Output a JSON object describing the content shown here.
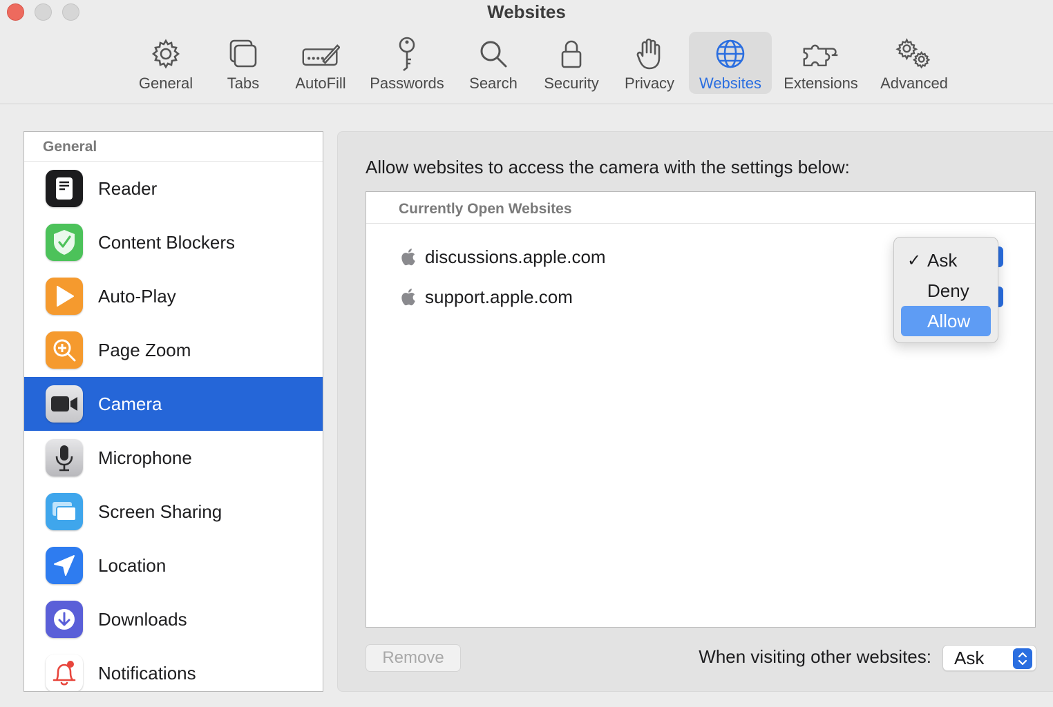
{
  "window": {
    "title": "Websites"
  },
  "toolbar": {
    "items": [
      {
        "label": "General",
        "icon": "gear-icon"
      },
      {
        "label": "Tabs",
        "icon": "tabs-icon"
      },
      {
        "label": "AutoFill",
        "icon": "autofill-pencil-icon"
      },
      {
        "label": "Passwords",
        "icon": "key-icon"
      },
      {
        "label": "Search",
        "icon": "magnifier-icon"
      },
      {
        "label": "Security",
        "icon": "lock-icon"
      },
      {
        "label": "Privacy",
        "icon": "hand-icon"
      },
      {
        "label": "Websites",
        "icon": "globe-icon",
        "active": true
      },
      {
        "label": "Extensions",
        "icon": "puzzle-icon"
      },
      {
        "label": "Advanced",
        "icon": "gears-icon"
      }
    ],
    "accent": "#2a6ee0"
  },
  "sidebar": {
    "header": "General",
    "items": [
      {
        "label": "Reader",
        "icon": "reader-icon",
        "color": "#1c1c1e"
      },
      {
        "label": "Content Blockers",
        "icon": "shield-check-icon",
        "color": "#4cc25a"
      },
      {
        "label": "Auto-Play",
        "icon": "play-icon",
        "color": "#f59a2e"
      },
      {
        "label": "Page Zoom",
        "icon": "zoom-icon",
        "color": "#f59a2e"
      },
      {
        "label": "Camera",
        "icon": "camera-icon",
        "color": "#6e6e73",
        "selected": true
      },
      {
        "label": "Microphone",
        "icon": "microphone-icon",
        "color": "#b8b8bc"
      },
      {
        "label": "Screen Sharing",
        "icon": "screen-sharing-icon",
        "color": "#3fa6ec"
      },
      {
        "label": "Location",
        "icon": "location-arrow-icon",
        "color": "#2e7cf0"
      },
      {
        "label": "Downloads",
        "icon": "download-icon",
        "color": "#5a5fd8"
      },
      {
        "label": "Notifications",
        "icon": "bell-icon",
        "color": "#ffffff"
      }
    ],
    "selected_color": "#2566d8"
  },
  "main": {
    "description": "Allow websites to access the camera with the settings below:",
    "list_header": "Currently Open Websites",
    "sites": [
      {
        "domain": "discussions.apple.com",
        "icon": "apple-icon",
        "setting": "Ask"
      },
      {
        "domain": "support.apple.com",
        "icon": "apple-icon"
      }
    ],
    "remove_label": "Remove",
    "other_label": "When visiting other websites:",
    "other_value": "Ask"
  },
  "popup_menu": {
    "options": [
      {
        "label": "Ask",
        "checked": true
      },
      {
        "label": "Deny"
      },
      {
        "label": "Allow",
        "highlighted": true
      }
    ],
    "check_glyph": "✓",
    "highlight_color": "#5e9cf4"
  }
}
